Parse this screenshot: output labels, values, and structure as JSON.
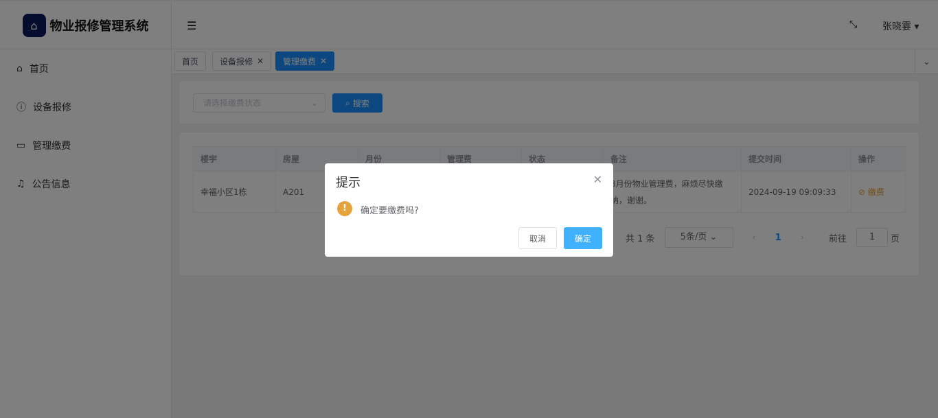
{
  "app": {
    "title": "物业报修管理系统",
    "user": "张晓霎"
  },
  "sidebar": {
    "items": [
      {
        "label": "首页",
        "icon": "home-icon"
      },
      {
        "label": "设备报修",
        "icon": "info-circle-icon"
      },
      {
        "label": "管理缴费",
        "icon": "card-icon"
      },
      {
        "label": "公告信息",
        "icon": "bell-icon"
      }
    ]
  },
  "tabs": [
    {
      "label": "首页"
    },
    {
      "label": "设备报修"
    },
    {
      "label": "管理缴费"
    }
  ],
  "search": {
    "placeholder": "请选择缴费状态",
    "button": "搜索"
  },
  "table": {
    "headers": [
      "楼宇",
      "房屋",
      "月份",
      "管理费",
      "状态",
      "备注",
      "提交时间",
      "操作"
    ],
    "rows": [
      {
        "building": "幸福小区1栋",
        "room": "A201",
        "remark": "8月份物业管理费，麻烦尽快缴纳，谢谢。",
        "time": "2024-09-19 09:09:33",
        "action": "缴费"
      }
    ]
  },
  "pager": {
    "total": "共 1 条",
    "size": "5条/页",
    "page": "1",
    "goto": "前往",
    "goto_value": "1",
    "page_unit": "页"
  },
  "dialog": {
    "title": "提示",
    "message": "确定要缴费吗?",
    "cancel": "取消",
    "confirm": "确定"
  },
  "colors": {
    "primary": "#1890ff",
    "warning": "#e6a23c",
    "confirm": "#409eff"
  }
}
